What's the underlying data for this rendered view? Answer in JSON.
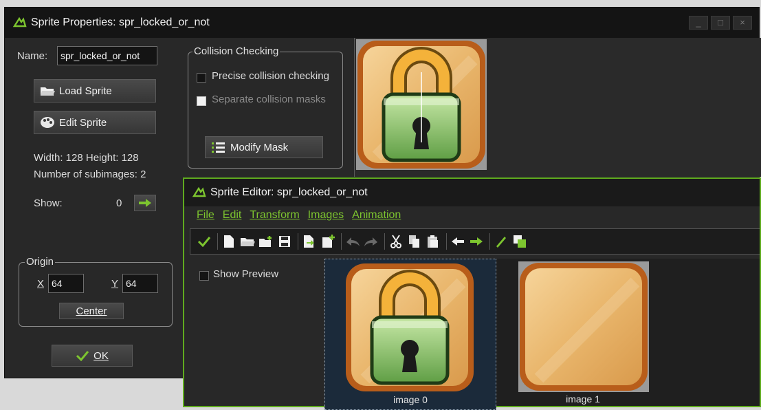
{
  "colors": {
    "accent": "#7dc52f",
    "editor_border": "#5faa1e",
    "selection": "#1b2a3a"
  },
  "props_window": {
    "title": "Sprite Properties: spr_locked_or_not",
    "controls": [
      "_",
      "□",
      "×"
    ],
    "name_label": "Name:",
    "name_value": "spr_locked_or_not",
    "load_sprite": "Load Sprite",
    "edit_sprite": "Edit Sprite",
    "width_height": "Width: 128   Height: 128",
    "subimages": "Number of subimages: 2",
    "show_label": "Show:",
    "show_value": "0",
    "origin": {
      "title": "Origin",
      "x_label": "X",
      "x_value": "64",
      "y_label": "Y",
      "y_value": "64",
      "center": "Center"
    },
    "ok": "OK",
    "collision": {
      "title": "Collision Checking",
      "precise": "Precise collision checking",
      "separate": "Separate collision masks",
      "modify_mask": "Modify Mask"
    }
  },
  "editor": {
    "title": "Sprite Editor: spr_locked_or_not",
    "menu": [
      "File",
      "Edit",
      "Transform",
      "Images",
      "Animation"
    ],
    "toolbar_icons": [
      "confirm-icon",
      "new-icon",
      "open-icon",
      "add-file-icon",
      "save-icon",
      "import-icon",
      "add-image-icon",
      "undo-icon",
      "redo-icon",
      "cut-icon",
      "copy-icon",
      "paste-icon",
      "previous-icon",
      "next-icon",
      "draw-icon",
      "color-icon"
    ],
    "show_preview": "Show Preview",
    "frames": [
      {
        "label": "image 0"
      },
      {
        "label": "image 1"
      }
    ]
  }
}
